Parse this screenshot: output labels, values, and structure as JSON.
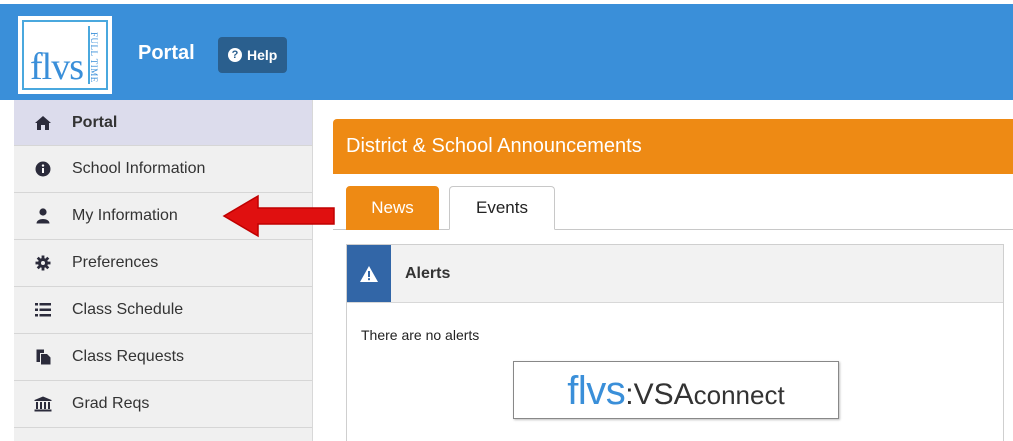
{
  "header": {
    "logo_text": "flvs",
    "logo_sub": "FULL TIME",
    "title": "Portal",
    "help_label": "Help",
    "help_icon": "question-circle-icon",
    "bg_color": "#3a8fd9"
  },
  "sidebar": {
    "items": [
      {
        "label": "Portal",
        "icon": "home-icon",
        "active": true
      },
      {
        "label": "School Information",
        "icon": "info-icon"
      },
      {
        "label": "My Information",
        "icon": "user-icon"
      },
      {
        "label": "Preferences",
        "icon": "gear-icon"
      },
      {
        "label": "Class Schedule",
        "icon": "list-icon"
      },
      {
        "label": "Class Requests",
        "icon": "copy-icon"
      },
      {
        "label": "Grad Reqs",
        "icon": "bank-icon"
      }
    ]
  },
  "main": {
    "panel_title": "District & School Announcements",
    "tabs": [
      {
        "label": "News",
        "active": true
      },
      {
        "label": "Events",
        "active": false
      }
    ],
    "alerts": {
      "title": "Alerts",
      "icon": "warning-icon",
      "empty_text": "There are no alerts"
    },
    "banner": {
      "part1": "flvs",
      "part2": ":",
      "part3": "VSA",
      "part4": "connect"
    }
  },
  "colors": {
    "accent_orange": "#ee8a14",
    "accent_blue": "#3266a7",
    "arrow_red": "#e01010"
  }
}
